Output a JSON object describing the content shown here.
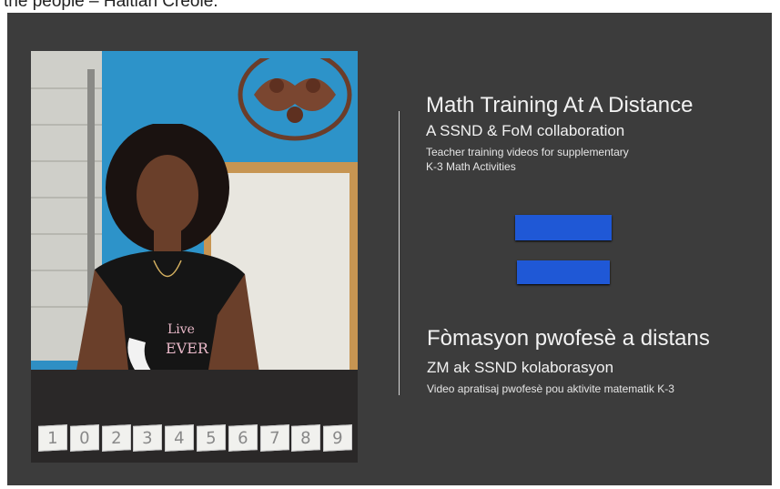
{
  "caption": "the people – Haitian Creole.",
  "slide": {
    "english": {
      "title": "Math Training At A Distance",
      "subtitle": "A SSND & FoM collaboration",
      "description_line1": "Teacher training videos for supplementary",
      "description_line2": "K-3 Math Activities"
    },
    "creole": {
      "title": "Fòmasyon pwofesè  a distans",
      "subtitle": "ZM ak SSND kolaborasyon",
      "description": "Video apratisaj pwofesè pou aktivite matematik K-3"
    },
    "photo": {
      "shirt_text_top": "Live",
      "shirt_text_bottom": "EVER",
      "number_cards": [
        "1",
        "0",
        "2",
        "3",
        "4",
        "5",
        "6",
        "7",
        "8",
        "9"
      ]
    },
    "colors": {
      "background": "#3c3c3c",
      "bars": "#1f58d6",
      "text": "#f2f2f2"
    }
  }
}
